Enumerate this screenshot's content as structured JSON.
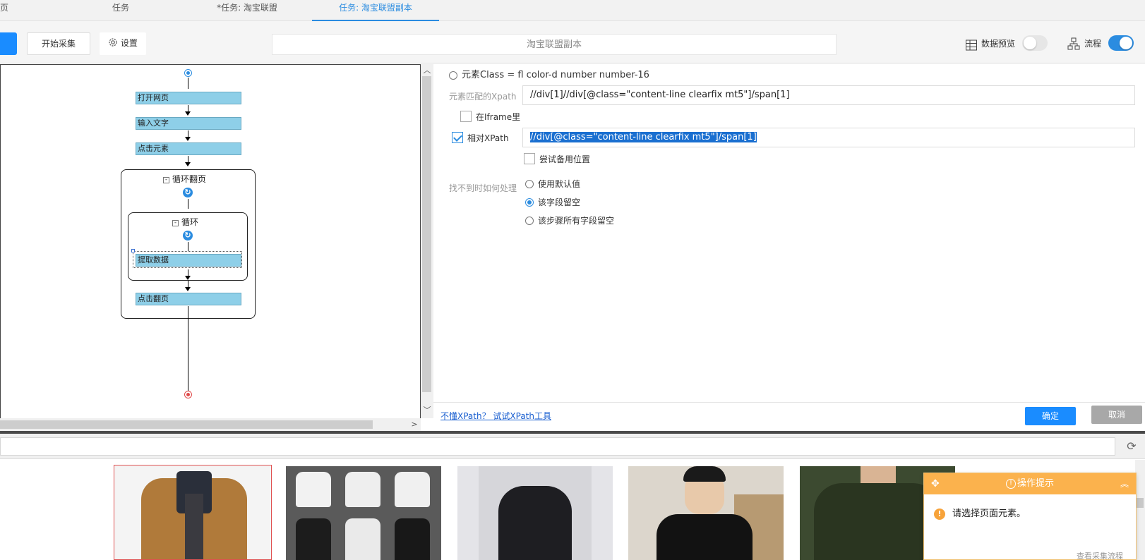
{
  "tabs": [
    {
      "label": "页"
    },
    {
      "label": "任务"
    },
    {
      "label": "*任务: 淘宝联盟"
    },
    {
      "label": "任务: 淘宝联盟副本"
    }
  ],
  "toolbar": {
    "start_label": "开始采集",
    "settings_label": "设置",
    "task_title": "淘宝联盟副本",
    "data_preview_label": "数据预览",
    "flow_label": "流程",
    "data_preview_on": false,
    "flow_on": true
  },
  "flow": {
    "nodes": {
      "open_page": "打开网页",
      "input_text": "输入文字",
      "click_element": "点击元素",
      "loop_pagination": "循环翻页",
      "loop": "循环",
      "extract_data": "提取数据",
      "click_next_page": "点击翻页"
    }
  },
  "settings": {
    "element_class_option": "元素Class = fl color-d number number-16",
    "xpath_label": "元素匹配的Xpath",
    "xpath_value": "//div[1]//div[@class=\"content-line clearfix mt5\"]/span[1]",
    "in_iframe_label": "在Iframe里",
    "in_iframe_checked": false,
    "relative_xpath_label": "相对XPath",
    "relative_xpath_checked": true,
    "relative_xpath_value": "//div[@class=\"content-line clearfix mt5\"]/span[1]",
    "try_backup_label": "尝试备用位置",
    "try_backup_checked": false,
    "not_found_label": "找不到时如何处理",
    "not_found_options": [
      {
        "label": "使用默认值",
        "selected": false
      },
      {
        "label": "该字段留空",
        "selected": true
      },
      {
        "label": "该步骤所有字段留空",
        "selected": false
      }
    ]
  },
  "footer": {
    "xpath_tool_link": "不懂XPath？ 试试XPath工具",
    "ok_label": "确定",
    "cancel_label": "取消"
  },
  "tip": {
    "title": "操作提示",
    "message": "请选择页面元素。",
    "footer_text": "查看采集流程"
  },
  "colors": {
    "accent": "#1a8cff",
    "node_fill": "#8ecfe8",
    "tip_header": "#fbb24d"
  }
}
